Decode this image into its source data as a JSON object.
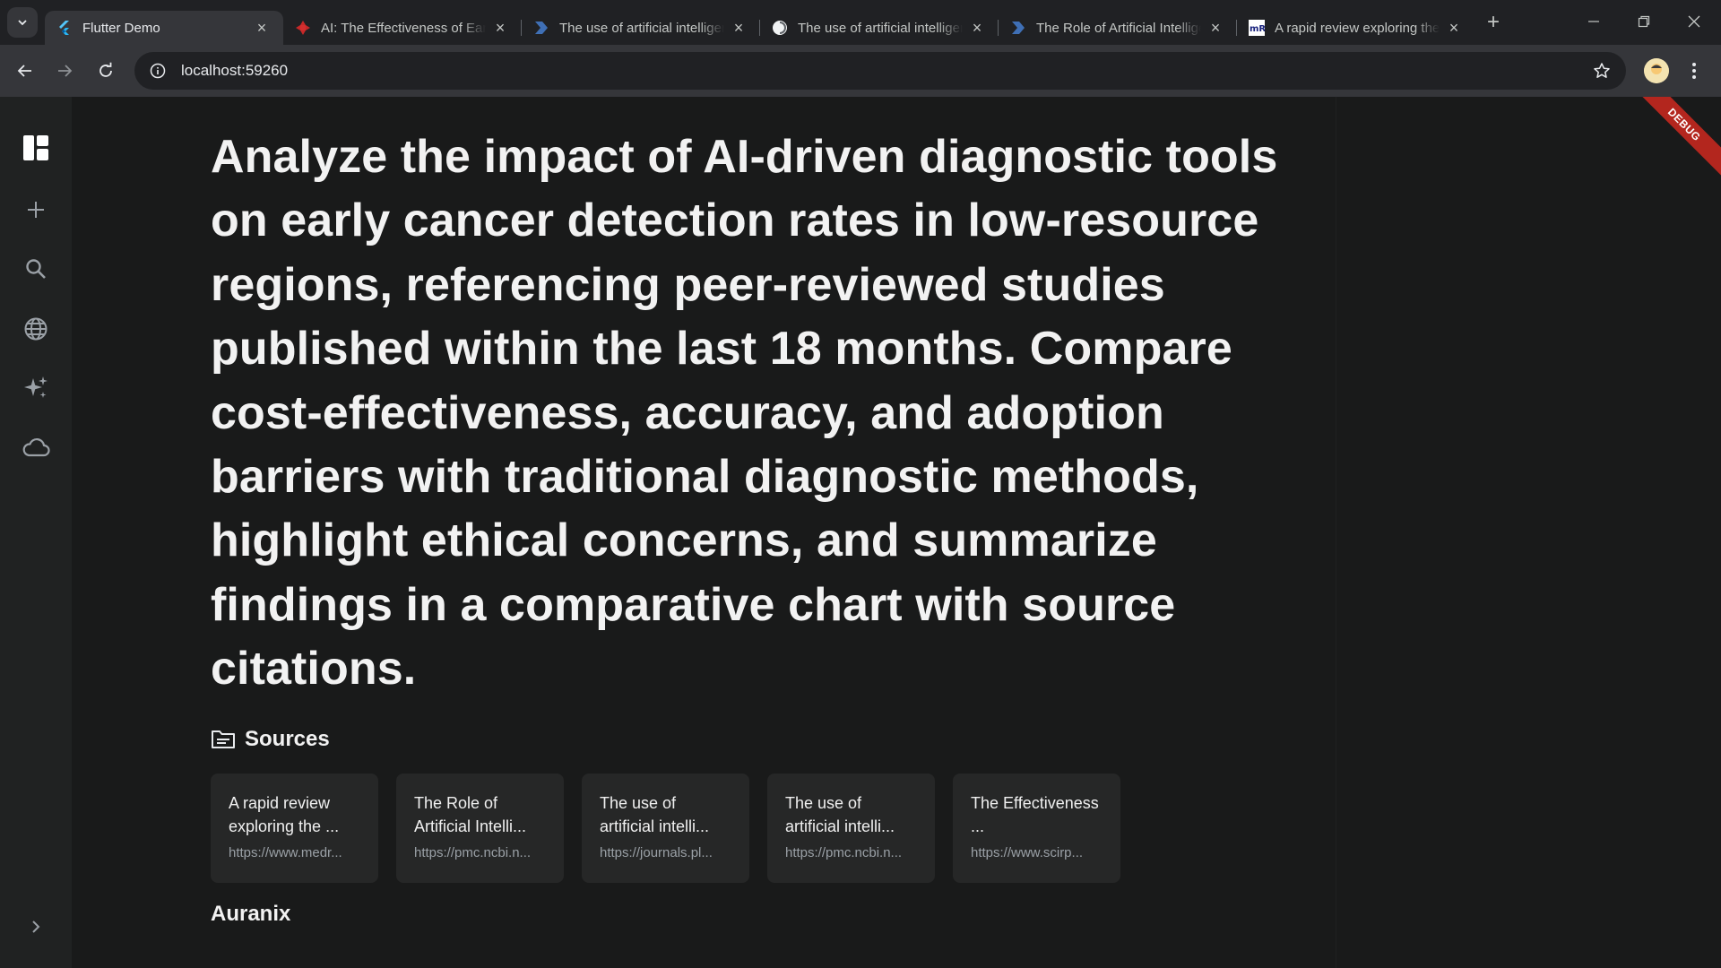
{
  "browser": {
    "tabs": [
      {
        "title": "Flutter Demo",
        "favicon": "flutter-icon",
        "active": true
      },
      {
        "title": "AI: The Effectiveness of Early Cancer Detection",
        "favicon": "scirp-icon",
        "active": false
      },
      {
        "title": "The use of artificial intelligence",
        "favicon": "journal-icon",
        "active": false
      },
      {
        "title": "The use of artificial intelligence",
        "favicon": "pmc-icon",
        "active": false
      },
      {
        "title": "The Role of Artificial Intelligence",
        "favicon": "journal-icon",
        "active": false
      },
      {
        "title": "A rapid review exploring the",
        "favicon": "medrxiv-icon",
        "active": false
      }
    ],
    "url": "localhost:59260"
  },
  "app": {
    "query": "Analyze the impact of AI-driven diagnostic tools on early cancer detection rates in low-resource regions, referencing peer-reviewed studies published within the last 18 months. Compare cost-effectiveness, accuracy, and adoption barriers with traditional diagnostic methods, highlight ethical concerns, and summarize findings in a comparative chart with source citations.",
    "sources_label": "Sources",
    "sources": [
      {
        "title": "A rapid review exploring the ...",
        "url": "https://www.medr..."
      },
      {
        "title": "The Role of Artificial Intelli...",
        "url": "https://pmc.ncbi.n..."
      },
      {
        "title": "The use of artificial intelli...",
        "url": "https://journals.pl..."
      },
      {
        "title": "The use of artificial intelli...",
        "url": "https://pmc.ncbi.n..."
      },
      {
        "title": "The Effectiveness ...",
        "url": "https://www.scirp..."
      }
    ],
    "answer_title": "Auranix",
    "debug_banner": "DEBUG"
  },
  "colors": {
    "accent_red": "#b3261e",
    "background": "#191a1a",
    "sidebar": "#202222",
    "card": "#262727"
  }
}
